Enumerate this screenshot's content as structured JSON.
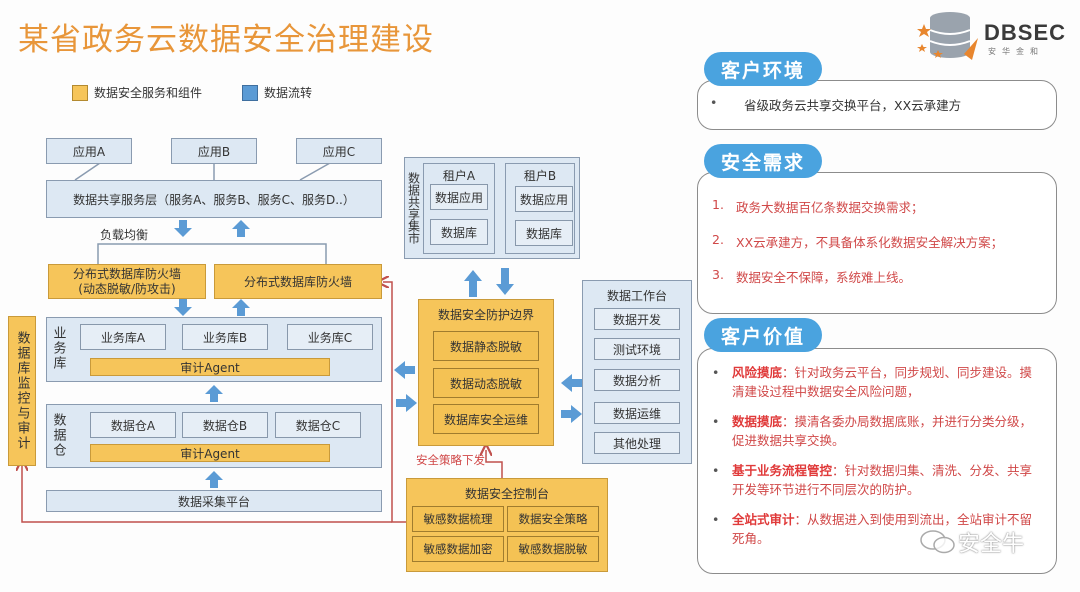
{
  "title": "某省政务云数据安全治理建设",
  "logo": {
    "name": "DBSEC",
    "subtitle": "安华金和"
  },
  "legend": [
    {
      "label": "数据安全服务和组件",
      "color": "#f6c55a"
    },
    {
      "label": "数据流转",
      "color": "#5b9bd5"
    }
  ],
  "apps": [
    "应用A",
    "应用B",
    "应用C"
  ],
  "service_layer": "数据共享服务层（服务A、服务B、服务C、服务D..）",
  "load_balance": "负载均衡",
  "firewalls": [
    {
      "line1": "分布式数据库防火墙",
      "line2": "(动态脱敏/防攻击)"
    },
    {
      "line1": "分布式数据库防火墙",
      "line2": ""
    }
  ],
  "business_db": {
    "label": "业务库",
    "items": [
      "业务库A",
      "业务库B",
      "业务库C"
    ],
    "agent": "审计Agent"
  },
  "warehouse": {
    "label": "数据仓",
    "items": [
      "数据仓A",
      "数据仓B",
      "数据仓C"
    ],
    "agent": "审计Agent"
  },
  "collect_platform": "数据采集平台",
  "monitor": "数据库监控与审计",
  "market": {
    "label": "数据共享集市",
    "tenants": [
      {
        "name": "租户A",
        "items": [
          "数据应用",
          "数据库"
        ]
      },
      {
        "name": "租户B",
        "items": [
          "数据应用",
          "数据库"
        ]
      }
    ]
  },
  "boundary": {
    "title": "数据安全防护边界",
    "items": [
      "数据静态脱敏",
      "数据动态脱敏",
      "数据库安全运维"
    ]
  },
  "policy_label": "安全策略下发",
  "console": {
    "title": "数据安全控制台",
    "items": [
      "敏感数据梳理",
      "数据安全策略",
      "敏感数据加密",
      "敏感数据脱敏"
    ]
  },
  "workbench": {
    "title": "数据工作台",
    "items": [
      "数据开发",
      "测试环境",
      "数据分析",
      "数据运维",
      "其他处理"
    ]
  },
  "env": {
    "title": "客户环境",
    "items": [
      "省级政务云共享交换平台，XX云承建方"
    ]
  },
  "needs": {
    "title": "安全需求",
    "items": [
      {
        "n": "1.",
        "text": "政务大数据百亿条数据交换需求；"
      },
      {
        "n": "2.",
        "text": "XX云承建方，不具备体系化数据安全解决方案；"
      },
      {
        "n": "3.",
        "text": "数据安全不保障，系统难上线。"
      }
    ]
  },
  "value": {
    "title": "客户价值",
    "items": [
      {
        "head": "风险摸底",
        "text": "：针对政务云平台，同步规划、同步建设。摸清建设过程中数据安全风险问题，"
      },
      {
        "head": "数据摸底",
        "text": "：摸清各委办局数据底账，并进行分类分级，促进数据共享交换。"
      },
      {
        "head": "基于业务流程管控",
        "text": "：针对数据归集、清洗、分发、共享开发等环节进行不同层次的防护。"
      },
      {
        "head": "全站式审计",
        "text": "：从数据进入到使用到流出，全站审计不留死角。"
      }
    ]
  },
  "watermark": "安全牛",
  "colors": {
    "title": "#e8963a",
    "accent_blue": "#4aa3df",
    "flow_arrow": "#5b9bd5",
    "component": "#f6c55a",
    "policy_line": "#c0504d",
    "red_text": "#d04848"
  }
}
